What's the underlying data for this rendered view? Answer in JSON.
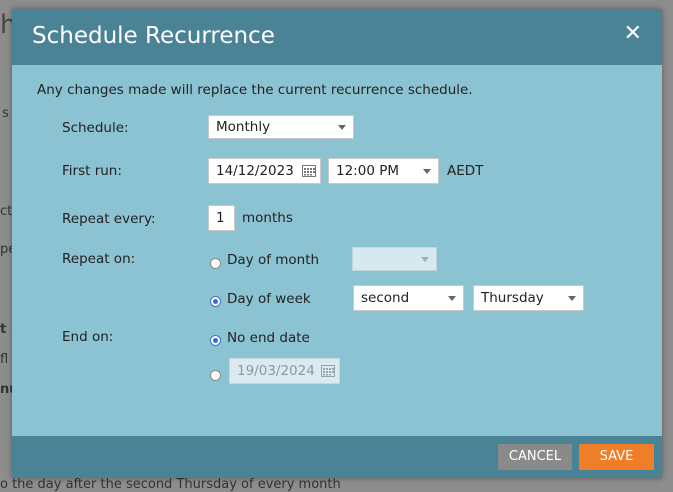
{
  "background": {
    "fragments": [
      "h",
      "s",
      "ct",
      "pe",
      "t (",
      "fl",
      "nu"
    ],
    "footer_text": "o the day after the second Thursday of every month"
  },
  "dialog": {
    "title": "Schedule Recurrence",
    "close_icon": "close-icon",
    "notice": "Any changes made will replace the current recurrence schedule.",
    "schedule": {
      "label": "Schedule:",
      "value": "Monthly"
    },
    "first_run": {
      "label": "First run:",
      "date": "14/12/2023",
      "time": "12:00 PM",
      "timezone": "AEDT"
    },
    "repeat_every": {
      "label": "Repeat every:",
      "value": "1",
      "unit": "months"
    },
    "repeat_on": {
      "label": "Repeat on:",
      "day_of_month": {
        "label": "Day of month",
        "checked": false,
        "value": ""
      },
      "day_of_week": {
        "label": "Day of week",
        "checked": true,
        "ordinal": "second",
        "weekday": "Thursday"
      }
    },
    "end_on": {
      "label": "End on:",
      "no_end_date": {
        "label": "No end date",
        "checked": true
      },
      "end_date": {
        "value": "19/03/2024",
        "checked": false
      }
    },
    "buttons": {
      "cancel": "CANCEL",
      "save": "SAVE"
    }
  },
  "colors": {
    "header": "#4b8396",
    "body": "#8cc3d3",
    "save": "#f07e28",
    "cancel": "#8a8a8a"
  }
}
